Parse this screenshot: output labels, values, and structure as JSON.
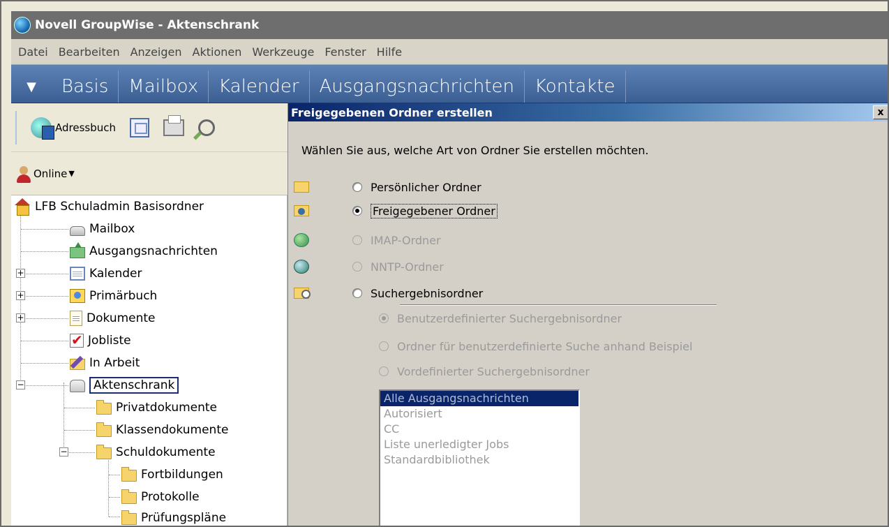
{
  "window": {
    "title": "Novell GroupWise - Aktenschrank"
  },
  "menu": [
    "Datei",
    "Bearbeiten",
    "Anzeigen",
    "Aktionen",
    "Werkzeuge",
    "Fenster",
    "Hilfe"
  ],
  "nav": {
    "tabs": [
      "Basis",
      "Mailbox",
      "Kalender",
      "Ausgangsnachrichten",
      "Kontakte"
    ]
  },
  "toolbar": {
    "addressbook_label": "Adressbuch"
  },
  "status": {
    "online_label": "Online"
  },
  "tree": {
    "root": "LFB Schuladmin Basisordner",
    "items": [
      "Mailbox",
      "Ausgangsnachrichten",
      "Kalender",
      "Primärbuch",
      "Dokumente",
      "Jobliste",
      "In Arbeit",
      "Aktenschrank",
      "Privatdokumente",
      "Klassendokumente",
      "Schuldokumente",
      "Fortbildungen",
      "Protokolle",
      "Prüfungspläne"
    ]
  },
  "dialog": {
    "title": "Freigegebenen Ordner erstellen",
    "close": "x",
    "prompt": "Wählen Sie aus, welche Art von Ordner Sie erstellen möchten.",
    "options": [
      "Persönlicher Ordner",
      "Freigegebener Ordner",
      "IMAP-Ordner",
      "NNTP-Ordner",
      "Suchergebnisordner"
    ],
    "sub_options": [
      "Benutzerdefinierter Suchergebnisordner",
      "Ordner für benutzerdefinierte Suche anhand Beispiel",
      "Vordefinierter Suchergebnisordner"
    ],
    "predefined_list": [
      "Alle Ausgangsnachrichten",
      "Autorisiert",
      "CC",
      "Liste unerledigter Jobs",
      "Standardbibliothek"
    ]
  }
}
